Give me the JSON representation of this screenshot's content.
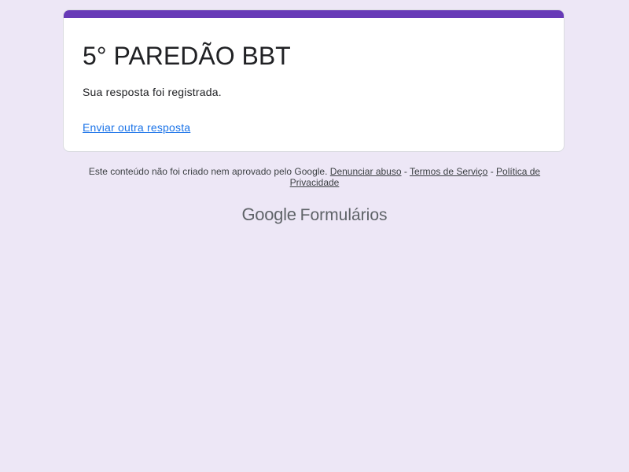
{
  "form": {
    "title": "5° PAREDÃO BBT",
    "confirmation_message": "Sua resposta foi registrada.",
    "another_response_link": "Enviar outra resposta"
  },
  "footer": {
    "disclaimer_text": "Este conteúdo não foi criado nem aprovado pelo Google.",
    "report_abuse_link": "Denunciar abuso",
    "separator": "-",
    "terms_link": "Termos de Serviço",
    "privacy_link": "Política de Privacidade"
  },
  "branding": {
    "google": "Google",
    "product": "Formulários"
  },
  "colors": {
    "background": "#ede7f6",
    "accent": "#673ab7",
    "link": "#1a73e8"
  }
}
